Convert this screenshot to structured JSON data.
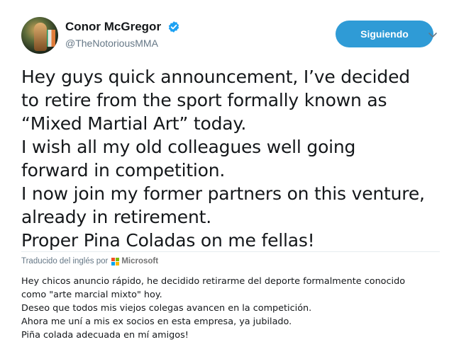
{
  "author": {
    "display_name": "Conor McGregor",
    "handle": "@TheNotoriousMMA",
    "verified_icon": "verified-badge",
    "avatar": "profile-photo"
  },
  "follow_button": {
    "label": "Siguiendo"
  },
  "menu_icon": "chevron-down-icon",
  "tweet": {
    "lines": [
      "Hey guys quick announcement, I’ve decided",
      "to retire from the sport formally known as",
      "“Mixed Martial Art” today.",
      "I wish all my old colleagues well going",
      "forward in competition.",
      "I now join my former partners on this venture,",
      "already in retirement.",
      "Proper Pina Coladas on me fellas!"
    ]
  },
  "translation": {
    "credit_label": "Traducido del inglés por",
    "provider": "Microsoft",
    "lines": [
      "Hey chicos anuncio rápido, he decidido retirarme del deporte formalmente conocido",
      "como \"arte marcial mixto\" hoy.",
      "Deseo que todos mis viejos colegas avancen en la competición.",
      "Ahora me uní a mis ex socios en esta empresa, ya jubilado.",
      "Piña colada adecuada en mí amigos!"
    ]
  },
  "colors": {
    "follow_button_bg": "#2f9bd6",
    "verified_blue": "#1da1f2",
    "secondary_text": "#657786",
    "ms_red": "#f25022",
    "ms_green": "#7fba00",
    "ms_blue": "#00a4ef",
    "ms_yellow": "#ffb900"
  }
}
